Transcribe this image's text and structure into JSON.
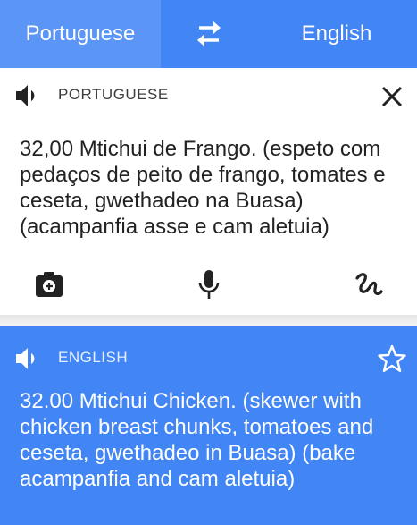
{
  "topbar": {
    "source_language": "Portuguese",
    "target_language": "English",
    "swap_icon": "swap-arrows-icon"
  },
  "source_panel": {
    "language_label": "PORTUGUESE",
    "text": "32,00 Mtichui de Frango. (espeto com pedaços de peito de frango, tomates e ceseta, gwethadeo na Buasa) (acampanfia asse e cam aletuia)",
    "icons": [
      "speaker-icon",
      "close-icon",
      "camera-icon",
      "microphone-icon",
      "handwriting-icon"
    ]
  },
  "result_panel": {
    "language_label": "ENGLISH",
    "text": "32.00 Mtichui Chicken. (skewer with chicken breast chunks, tomatoes and ceseta, gwethadeo in Buasa) (bake acampanfia and cam aletuia)",
    "icons": [
      "speaker-icon",
      "star-icon"
    ]
  },
  "colors": {
    "brand_blue": "#4285f4",
    "tab_highlight": "#5b95f5",
    "text_dark": "#222222"
  }
}
